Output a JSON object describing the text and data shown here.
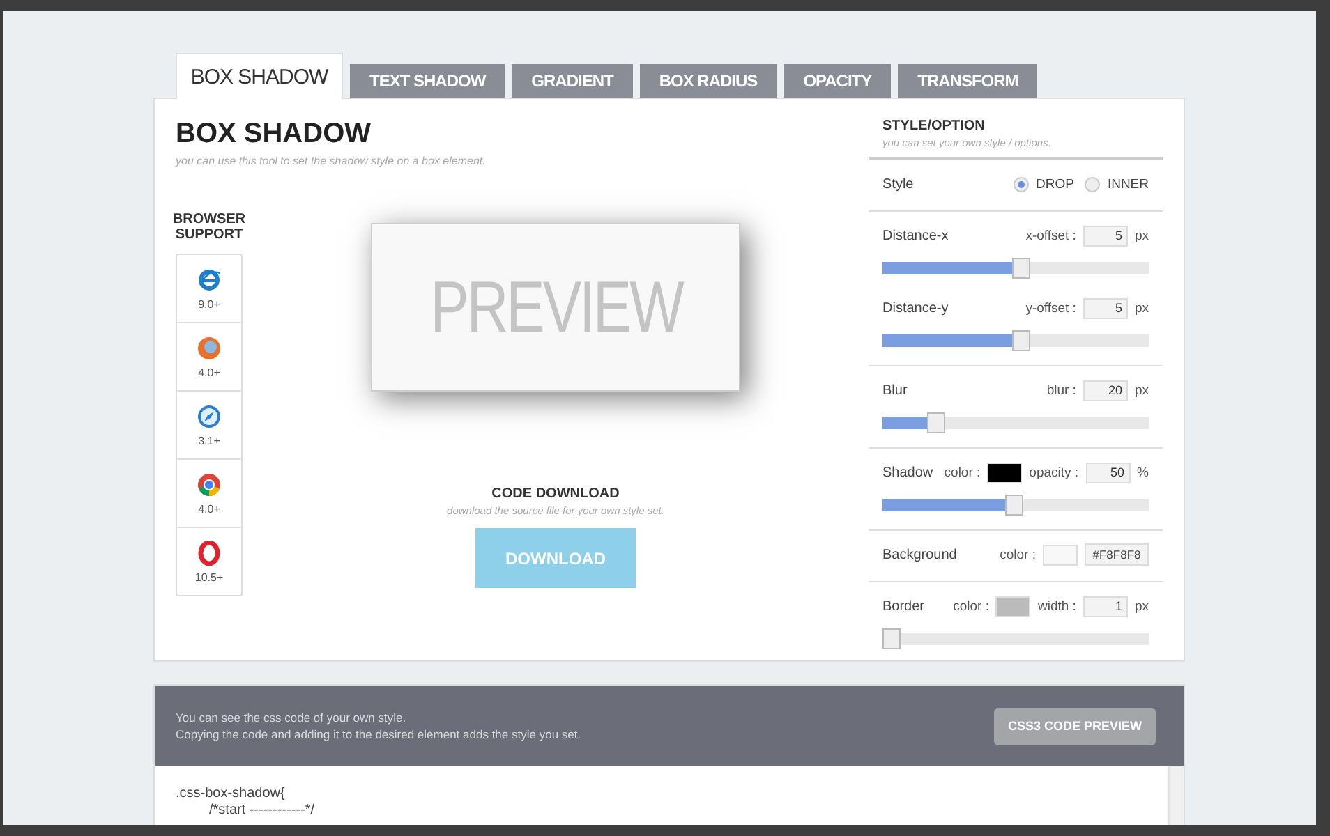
{
  "tabs": [
    {
      "label": "BOX SHADOW",
      "selected": true
    },
    {
      "label": "TEXT SHADOW",
      "selected": false
    },
    {
      "label": "GRADIENT",
      "selected": false
    },
    {
      "label": "BOX RADIUS",
      "selected": false
    },
    {
      "label": "OPACITY",
      "selected": false
    },
    {
      "label": "TRANSFORM",
      "selected": false
    }
  ],
  "main": {
    "title": "BOX SHADOW",
    "subtitle": "you can use this tool to set the shadow style on a box element."
  },
  "browser_support": {
    "title": "BROWSER SUPPORT",
    "browsers": [
      {
        "kind": "ie",
        "version": "9.0+"
      },
      {
        "kind": "firefox",
        "version": "4.0+"
      },
      {
        "kind": "safari",
        "version": "3.1+"
      },
      {
        "kind": "chrome",
        "version": "4.0+"
      },
      {
        "kind": "opera",
        "version": "10.5+"
      }
    ]
  },
  "preview": {
    "text": "PREVIEW"
  },
  "download": {
    "title": "CODE DOWNLOAD",
    "subtitle": "download the source file for your own style set.",
    "button": "DOWNLOAD"
  },
  "options": {
    "title": "STYLE/OPTION",
    "subtitle": "you can set your own style / options.",
    "groups": [
      {
        "rows": [
          {
            "kind": "radio",
            "label": "Style",
            "choices": [
              {
                "label": "DROP",
                "selected": true
              },
              {
                "label": "INNER",
                "selected": false
              }
            ]
          }
        ]
      },
      {
        "rows": [
          {
            "kind": "slider",
            "label": "Distance-x",
            "fields": [
              {
                "kind": "input",
                "label": "x-offset :",
                "value": "5",
                "unit": "px"
              }
            ],
            "level": 0.52
          },
          {
            "kind": "slider",
            "label": "Distance-y",
            "fields": [
              {
                "kind": "input",
                "label": "y-offset :",
                "value": "5",
                "unit": "px"
              }
            ],
            "level": 0.52
          }
        ]
      },
      {
        "rows": [
          {
            "kind": "slider",
            "label": "Blur",
            "fields": [
              {
                "kind": "input",
                "label": "blur :",
                "value": "20",
                "unit": "px"
              }
            ],
            "level": 0.2
          }
        ]
      },
      {
        "rows": [
          {
            "kind": "slider",
            "label": "Shadow",
            "fields": [
              {
                "kind": "swatch",
                "label": "color :",
                "color": "#000000"
              },
              {
                "kind": "input",
                "label": "opacity :",
                "value": "50",
                "unit": "%"
              }
            ],
            "level": 0.49
          }
        ]
      },
      {
        "rows": [
          {
            "kind": "plain",
            "label": "Background",
            "fields": [
              {
                "kind": "swatch",
                "label": "color :",
                "color": "#f8f8f8"
              },
              {
                "kind": "text",
                "value": "#F8F8F8"
              }
            ]
          }
        ]
      },
      {
        "rows": [
          {
            "kind": "slider",
            "label": "Border",
            "fields": [
              {
                "kind": "swatch",
                "label": "color :",
                "color": "#bbbbbb"
              },
              {
                "kind": "input",
                "label": "width :",
                "value": "1",
                "unit": "px"
              }
            ],
            "level": 0
          }
        ]
      }
    ]
  },
  "code_panel": {
    "lines": [
      "You can see the css code of your own style.",
      "Copying the code and adding it to the desired element adds the style you set."
    ],
    "button": "CSS3 CODE PREVIEW",
    "code": [
      {
        "text": ".css-box-shadow{",
        "children": [
          {
            "text": "/*start ------------*/"
          }
        ]
      }
    ]
  }
}
